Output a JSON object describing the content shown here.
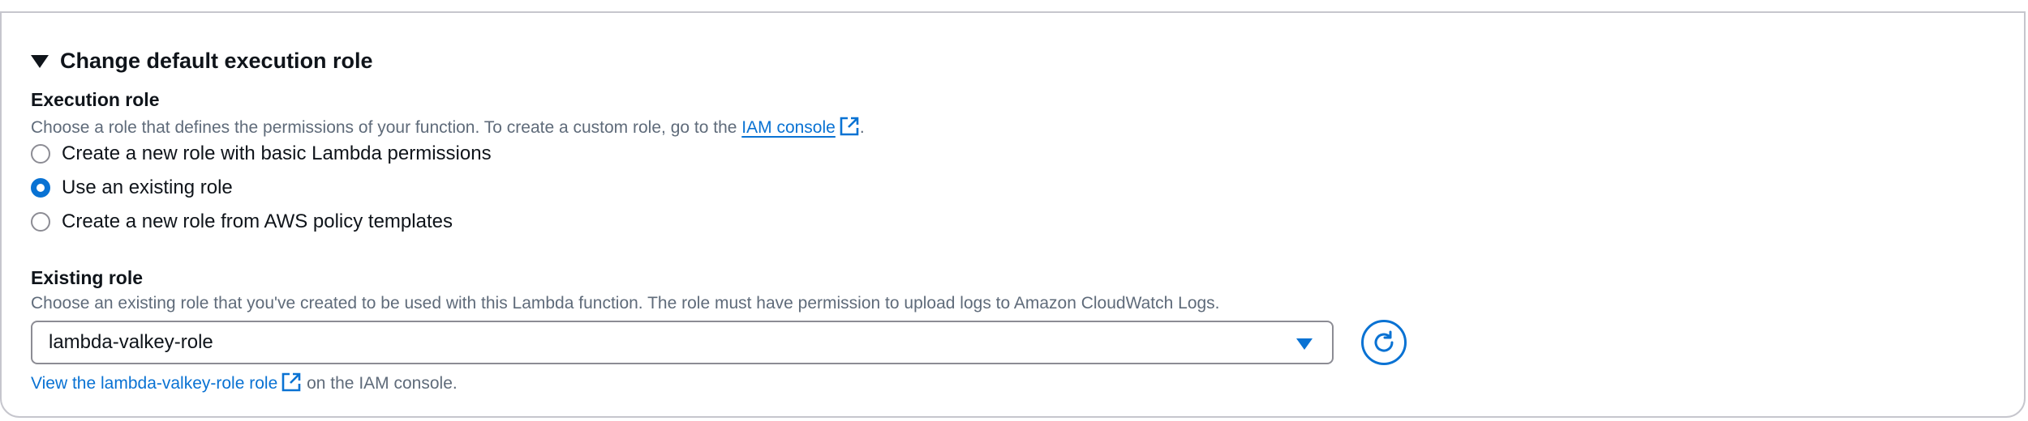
{
  "section": {
    "title": "Change default execution role"
  },
  "execution_role": {
    "label": "Execution role",
    "desc_prefix": "Choose a role that defines the permissions of your function. To create a custom role, go to the ",
    "desc_link": "IAM console",
    "desc_suffix": ".",
    "options": [
      {
        "label": "Create a new role with basic Lambda permissions",
        "selected": false
      },
      {
        "label": "Use an existing role",
        "selected": true
      },
      {
        "label": "Create a new role from AWS policy templates",
        "selected": false
      }
    ]
  },
  "existing_role": {
    "label": "Existing role",
    "description": "Choose an existing role that you've created to be used with this Lambda function. The role must have permission to upload logs to Amazon CloudWatch Logs.",
    "selected_value": "lambda-valkey-role",
    "view_link": "View the lambda-valkey-role role",
    "view_suffix": " on the IAM console."
  },
  "colors": {
    "link": "#0972d3",
    "text": "#0f141a",
    "muted": "#5f6b7a",
    "border": "#8c8c94"
  },
  "icons": {
    "section_toggle": "caret-down-icon",
    "external_link": "external-link-icon",
    "dropdown": "caret-down-filled-icon",
    "refresh": "refresh-icon"
  }
}
